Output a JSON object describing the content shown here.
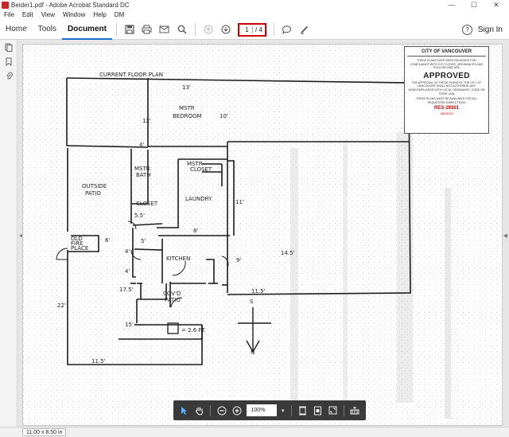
{
  "window": {
    "title": "Beider1.pdf - Adobe Acrobat Standard DC",
    "minimize": "—",
    "maximize": "☐",
    "close": "✕"
  },
  "menu": [
    "File",
    "Edit",
    "View",
    "Window",
    "Help",
    "DM"
  ],
  "toolbar": {
    "tabs": [
      {
        "label": "Home",
        "active": false
      },
      {
        "label": "Tools",
        "active": false
      },
      {
        "label": "Document",
        "active": true
      }
    ],
    "current_page": "1",
    "total_pages": "/ 4",
    "help": "?",
    "sign_in": "Sign In"
  },
  "document": {
    "plan_title": "CURRENT FLOOR PLAN",
    "rooms": {
      "mstr_bedroom": [
        "MSTR",
        "BEDROOM"
      ],
      "mstr_bath": [
        "MSTR.",
        "BATH"
      ],
      "mstr_closet": [
        "MSTR",
        "CLOSET"
      ],
      "laundry": "LAUNDRY",
      "outside_patio": [
        "OUTSIDE",
        "PATIO"
      ],
      "closet": "CLOSET",
      "kitchen": "KITCHEN",
      "covd_patio": [
        "COV'D",
        "PATIO"
      ],
      "old_fireplace": [
        "OLD",
        "FIRE",
        "PLACE"
      ]
    },
    "dimensions": [
      "13'",
      "10'",
      "12'",
      "4'",
      "5.5'",
      "11'",
      "8'",
      "6'",
      "5'",
      "9'",
      "14.5'",
      "11.5'",
      "17.5'",
      "15'",
      "22'",
      "11.5'",
      "4'",
      "4'"
    ],
    "legend": "= 2.6 FT.",
    "compass": [
      "S",
      "N"
    ],
    "stamp": {
      "city": "CITY OF VANCOUVER",
      "reviewed": "THESE PLANS HAVE BEEN REVIEWED FOR COMPLIANCE WITH CITY CODES, ORDINANCES AND POLICIES AND ARE",
      "approved": "APPROVED",
      "approval_note": "THE APPROVAL OF THESE PLANS BY THE CITY OF VANCOUVER SHALL NOT AUTHORIZE ANY NONCOMPLIANCE WITH LOCAL ORDINANCE, CODE OR STATE LAW",
      "available": "THESE PLANS MUST BE AVAILABLE FOR ALL REQUESTED INSPECTIONS",
      "permit": "RES-29301",
      "date": "08/05/19"
    }
  },
  "floating_toolbar": {
    "zoom": "100%"
  },
  "status": {
    "page_size": "11.00 x 8.50 in"
  }
}
